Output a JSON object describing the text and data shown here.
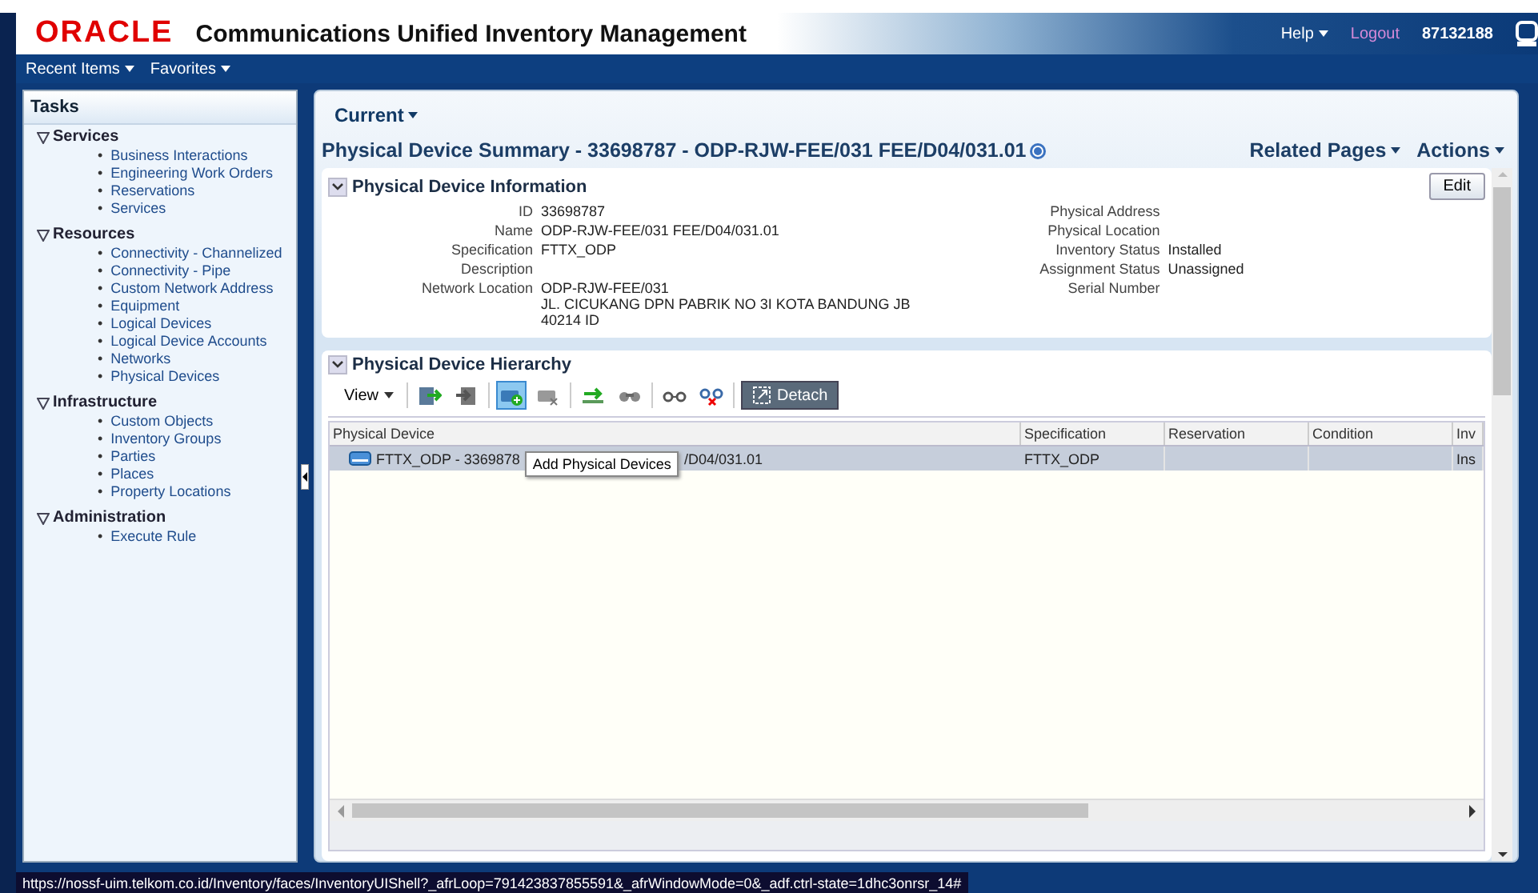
{
  "header": {
    "logo": "ORACLE",
    "title": "Communications Unified Inventory Management",
    "help": "Help",
    "logout": "Logout",
    "user": "87132188"
  },
  "nav": [
    "Recent Items",
    "Favorites"
  ],
  "tasks": {
    "title": "Tasks",
    "bullet": "•",
    "groups": [
      {
        "label": "Services",
        "expanded": true,
        "items": [
          "Business Interactions",
          "Engineering Work Orders",
          "Reservations",
          "Services"
        ]
      },
      {
        "label": "Resources",
        "expanded": true,
        "items": [
          "Connectivity - Channelized",
          "Connectivity - Pipe",
          "Custom Network Address",
          "Equipment",
          "Logical Devices",
          "Logical Device Accounts",
          "Networks",
          "Physical Devices"
        ]
      },
      {
        "label": "Infrastructure",
        "expanded": true,
        "items": [
          "Custom Objects",
          "Inventory Groups",
          "Parties",
          "Places",
          "Property Locations"
        ]
      },
      {
        "label": "Administration",
        "expanded": true,
        "items": [
          "Execute Rule"
        ]
      }
    ]
  },
  "current": "Current",
  "page_title": "Physical Device Summary - 33698787 - ODP-RJW-FEE/031 FEE/D04/031.01",
  "page_menus": [
    "Related Pages",
    "Actions"
  ],
  "info": {
    "title": "Physical Device Information",
    "expanded": true,
    "edit": "Edit",
    "left": [
      {
        "label": "ID",
        "value": "33698787"
      },
      {
        "label": "Name",
        "value": "ODP-RJW-FEE/031 FEE/D04/031.01"
      },
      {
        "label": "Specification",
        "value": "FTTX_ODP"
      },
      {
        "label": "Description"
      },
      {
        "label": "Network Location",
        "value": "ODP-RJW-FEE/031",
        "lines": [
          "JL. CICUKANG DPN PABRIK NO 3I KOTA BANDUNG JB",
          "40214 ID"
        ]
      }
    ],
    "right": [
      {
        "label": "Physical Address"
      },
      {
        "label": "Physical Location"
      },
      {
        "label": "Inventory Status",
        "value": "Installed"
      },
      {
        "label": "Assignment Status",
        "value": "Unassigned"
      },
      {
        "label": "Serial Number"
      }
    ]
  },
  "hierarchy": {
    "title": "Physical Device Hierarchy",
    "expanded": true,
    "view": "View",
    "tools": [
      {
        "kind": "import",
        "selected": false
      },
      {
        "kind": "export",
        "selected": false
      },
      {
        "kind": "add",
        "selected": true
      },
      {
        "kind": "remove",
        "selected": false
      },
      {
        "kind": "move",
        "selected": false
      },
      {
        "kind": "find",
        "selected": false
      },
      {
        "kind": "link",
        "selected": false
      },
      {
        "kind": "unlink",
        "selected": false
      }
    ],
    "detach": "Detach",
    "columns": [
      "Physical Device",
      "Specification",
      "Reservation",
      "Condition",
      "Inv"
    ],
    "rows": [
      {
        "selected": true,
        "device_start": "FTTX_ODP - 3369878",
        "device_end": "/D04/031.01",
        "specification": "FTTX_ODP",
        "column_5": "Ins"
      }
    ],
    "tooltip": "Add Physical Devices"
  },
  "status_url": "https://nossf-uim.telkom.co.id/Inventory/faces/InventoryUIShell?_afrLoop=791423837855591&_afrWindowMode=0&_adf.ctrl-state=1dhc3onrsr_14#"
}
